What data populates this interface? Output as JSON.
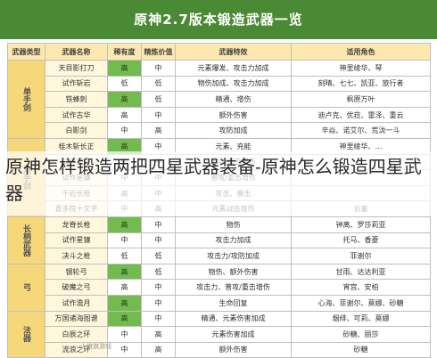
{
  "title": "原神2.7版本锻造武器一览",
  "overlay_caption": "原神怎样锻造两把四星武器装备-原神怎么锻造四星武器",
  "watermark": "火旗旗游戏",
  "table": {
    "headers": [
      "武器类型",
      "武器名称",
      "稀有度",
      "精炼价值",
      "武器特效",
      "适用角色"
    ],
    "groups": [
      {
        "category": "单手剑",
        "rows": [
          [
            "",
            "天目影打刀",
            "高",
            "中",
            "元素爆发、攻击力加成",
            "神里绫华、琴"
          ],
          [
            "",
            "试作斩岩",
            "低",
            "低",
            "物伤加成、攻击力加成",
            "刻晴、七七、凯亚、旅行者"
          ],
          [
            "",
            "铁蜂刺",
            "高",
            "低",
            "精通、增伤",
            "枫原万叶"
          ],
          [
            "",
            "试作古华",
            "高",
            "中",
            "额外伤害",
            "迪卢克、优菈、雷泽、重云"
          ],
          [
            "",
            "白影剑",
            "中",
            "高",
            "攻防加成",
            "辛焱、诺艾尔、荒泷一斗"
          ]
        ]
      },
      {
        "category": "双手剑",
        "rows": [
          [
            "",
            "桂木斩长正",
            "高",
            "中",
            "元素、充能",
            "神里绫华、…"
          ],
          [
            "",
            "试作星镰",
            "中",
            "中",
            "普攻/重击增伤",
            ""
          ],
          [
            "",
            "试作星镰",
            "中",
            "中",
            "普攻/重击增伤",
            ""
          ],
          [
            "",
            "千岩长枪",
            "高",
            "中",
            "攻击、暴击",
            ""
          ],
          [
            "",
            "喜多院十文字",
            "中",
            "高",
            "元素战技增伤",
            "云堇"
          ]
        ]
      },
      {
        "category": "长柄武器",
        "rows": [
          [
            "",
            "龙脊长枪",
            "高",
            "中",
            "物伤",
            "钟离、罗莎莉亚"
          ],
          [
            "",
            "试作星镰",
            "中",
            "中",
            "攻击力加成",
            "托马、香菱"
          ],
          [
            "",
            "决斗之枪",
            "低",
            "低",
            "攻击力/攻防加成",
            "菲谢尔"
          ]
        ]
      },
      {
        "category": "弓",
        "rows": [
          [
            "",
            "钢轮弓",
            "高",
            "低",
            "物伤、额外伤害",
            "甘雨、达达利亚"
          ],
          [
            "",
            "破魔之弓",
            "高",
            "中",
            "攻击力、普攻/重击增伤",
            "宵宫、安柏"
          ],
          [
            "",
            "试作澹月",
            "高",
            "中",
            "生命回复",
            "心海、菲谢尔、莫娜、砂糖"
          ]
        ]
      },
      {
        "category": "法器",
        "rows": [
          [
            "",
            "万国诸海图谱",
            "高",
            "中",
            "精通、元素伤害加成",
            "烟绯、可莉、莫娜"
          ],
          [
            "",
            "白辰之环",
            "中",
            "高",
            "元素伤害加成",
            "砂糖、丽莎"
          ],
          [
            "",
            "流浪之环",
            "中",
            "高",
            "额外伤害",
            "砂糖"
          ]
        ]
      }
    ]
  },
  "colors": {
    "title_bg": "#4b8a34",
    "header_bg": "#fde9b0",
    "category_bg": "#f6d77a",
    "highlight": "#74bb4f"
  }
}
